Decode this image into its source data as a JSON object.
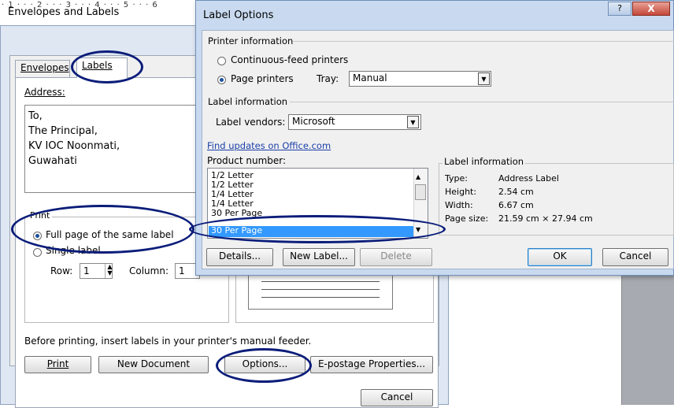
{
  "ruler": {
    "text": "· 1 · · · 2 · · · 3 · · · 4 · · · 5 · · · 6"
  },
  "envelopes_dialog": {
    "title": "Envelopes and Labels",
    "tabs": {
      "envelopes": "Envelopes",
      "labels": "Labels"
    },
    "address_label": "Address:",
    "address_lines": [
      "To,",
      "The Principal,",
      "KV IOC Noonmati,",
      "Guwahati"
    ],
    "print_group": {
      "legend": "Print",
      "full_page": "Full page of the same label",
      "single_label": "Single label",
      "row_label": "Row:",
      "row_value": "1",
      "column_label": "Column:",
      "column_value": "1"
    },
    "feeder_note": "Before printing, insert labels in your printer's manual feeder.",
    "buttons": {
      "print": "Print",
      "new_document": "New Document",
      "options": "Options...",
      "epostage": "E-postage Properties...",
      "cancel": "Cancel"
    }
  },
  "label_options": {
    "title": "Label Options",
    "help": "?",
    "close": "X",
    "printer_info": "Printer information",
    "continuous_feed": "Continuous-feed printers",
    "page_printers": "Page printers",
    "tray_label": "Tray:",
    "tray_value": "Manual",
    "label_info": "Label information",
    "vendors_label": "Label vendors:",
    "vendors_value": "Microsoft",
    "find_updates": "Find updates on Office.com",
    "product_number_label": "Product number:",
    "products": [
      "1/2 Letter",
      "1/2 Letter",
      "1/4 Letter",
      "1/4 Letter",
      "30 Per Page"
    ],
    "selected_product": "30 Per Page",
    "info_box": {
      "legend": "Label information",
      "rows": [
        {
          "k": "Type:",
          "v": "Address Label"
        },
        {
          "k": "Height:",
          "v": "2.54 cm"
        },
        {
          "k": "Width:",
          "v": "6.67 cm"
        },
        {
          "k": "Page size:",
          "v": "21.59 cm × 27.94 cm"
        }
      ]
    },
    "buttons": {
      "details": "Details...",
      "new_label": "New Label...",
      "delete": "Delete",
      "ok": "OK",
      "cancel": "Cancel"
    }
  },
  "colors": {
    "annotation": "#0b1d7a",
    "selection": "#3399ff",
    "link": "#1a3fa8"
  }
}
